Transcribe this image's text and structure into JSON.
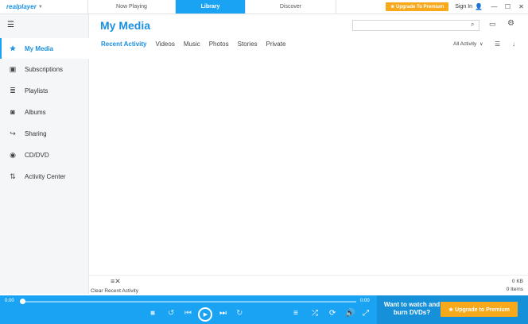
{
  "app": {
    "logo_text": "realplayer"
  },
  "top_tabs": [
    {
      "label": "Now Playing",
      "active": false
    },
    {
      "label": "Library",
      "active": true
    },
    {
      "label": "Discover",
      "active": false
    }
  ],
  "header": {
    "upgrade_label": "★ Upgrade To Premium",
    "signin_label": "Sign In"
  },
  "sidebar": {
    "items": [
      {
        "label": "My Media",
        "icon": "star-icon",
        "active": true
      },
      {
        "label": "Subscriptions",
        "icon": "subscriptions-icon"
      },
      {
        "label": "Playlists",
        "icon": "playlist-icon"
      },
      {
        "label": "Albums",
        "icon": "album-icon"
      },
      {
        "label": "Sharing",
        "icon": "share-icon"
      },
      {
        "label": "CD/DVD",
        "icon": "disc-icon"
      },
      {
        "label": "Activity Center",
        "icon": "activity-icon"
      }
    ]
  },
  "main": {
    "title": "My Media",
    "search": {
      "value": "",
      "placeholder": ""
    },
    "subtabs": [
      {
        "label": "Recent Activity",
        "active": true
      },
      {
        "label": "Videos"
      },
      {
        "label": "Music"
      },
      {
        "label": "Photos"
      },
      {
        "label": "Stories"
      },
      {
        "label": "Private"
      }
    ],
    "filter_label": "All Activity"
  },
  "status": {
    "clear_label": "Clear Recent Activity",
    "size": "0 KB",
    "count": "0 Items"
  },
  "player": {
    "time_start": "0:00",
    "time_end": "0:00",
    "progress": 0
  },
  "promo": {
    "text": "Want to watch and burn DVDs?",
    "button": "★ Upgrade to Premium"
  },
  "colors": {
    "accent": "#1ba3f3",
    "upgrade": "#f7a81b",
    "title_blue": "#1b8fe0"
  }
}
